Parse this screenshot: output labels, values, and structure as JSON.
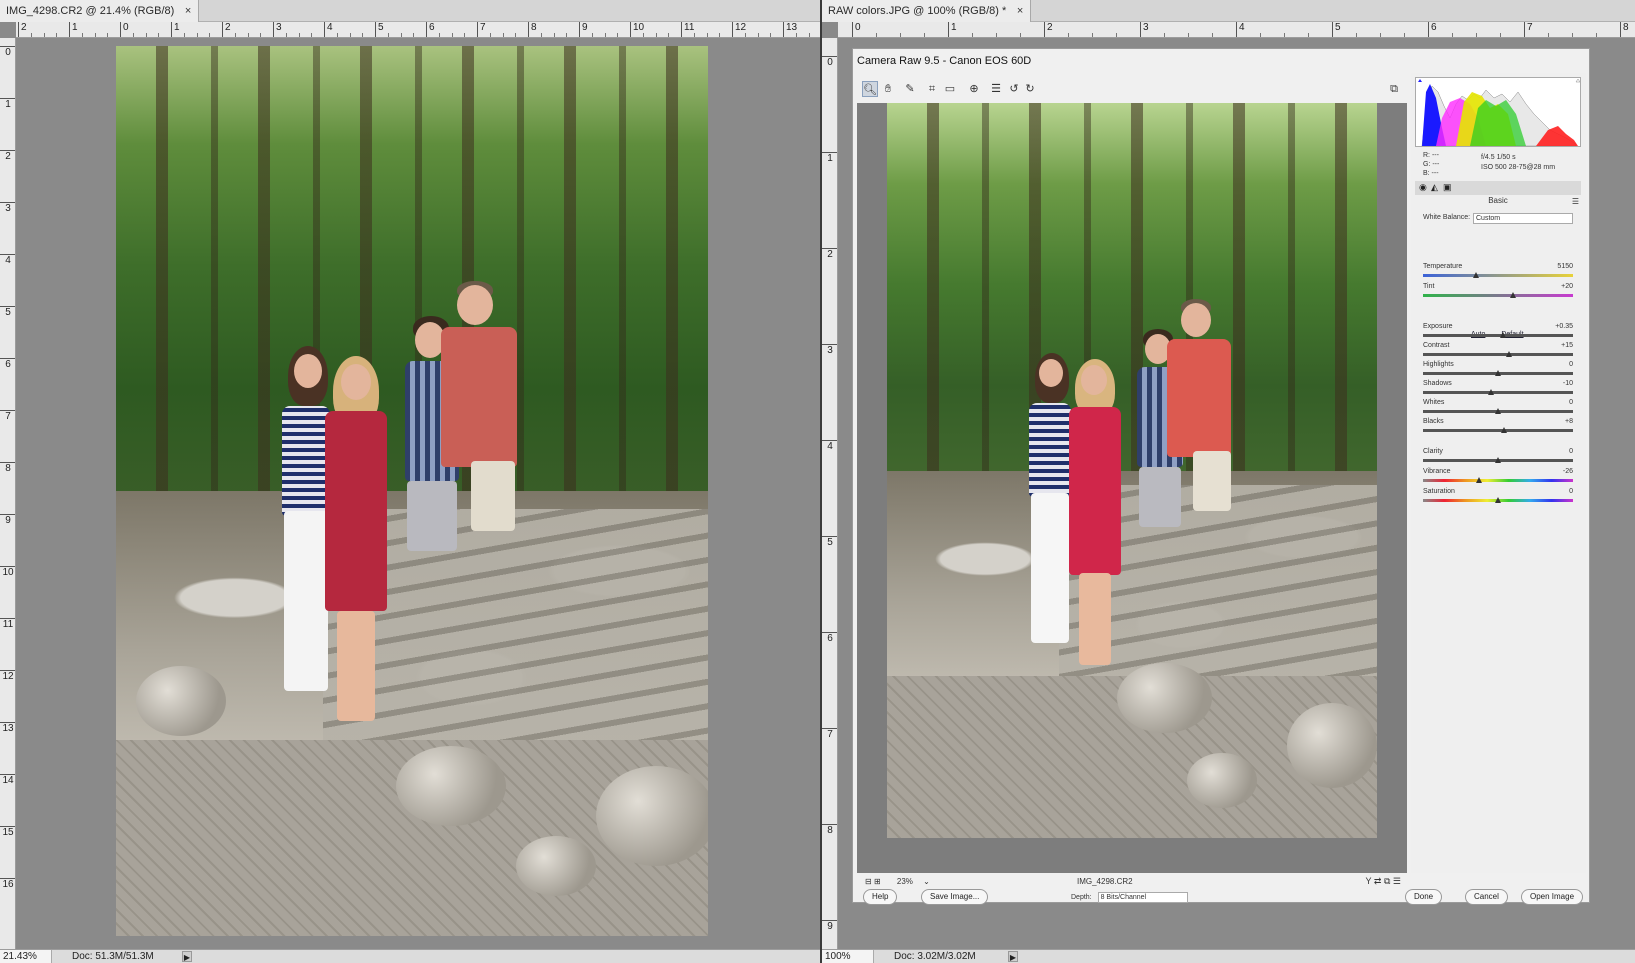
{
  "left_doc": {
    "tab_title": "IMG_4298.CR2 @ 21.4% (RGB/8)",
    "close_glyph": "×",
    "ruler_top_labels": [
      "2",
      "1",
      "0",
      "1",
      "2",
      "3",
      "4",
      "5",
      "6",
      "7",
      "8",
      "9",
      "10",
      "11",
      "12",
      "13"
    ],
    "ruler_left_labels": [
      "0",
      "1",
      "2",
      "3",
      "4",
      "5",
      "6",
      "7",
      "8",
      "9",
      "10",
      "11",
      "12",
      "13",
      "14",
      "15",
      "16"
    ],
    "status_zoom": "21.43%",
    "status_doc": "Doc: 51.3M/51.3M"
  },
  "right_doc": {
    "tab_title": "RAW colors.JPG @ 100% (RGB/8) *",
    "close_glyph": "×",
    "ruler_top_labels": [
      "0",
      "1",
      "2",
      "3",
      "4",
      "5",
      "6",
      "7",
      "8"
    ],
    "ruler_left_labels": [
      "0",
      "1",
      "2",
      "3",
      "4",
      "5",
      "6",
      "7",
      "8",
      "9"
    ],
    "status_zoom": "100%",
    "status_doc": "Doc: 3.02M/3.02M"
  },
  "camera_raw": {
    "title": "Camera Raw 9.5  -  Canon EOS 60D",
    "histogram_readout": {
      "r": "R:   ---",
      "g": "G:   ---",
      "b": "B:   ---",
      "aperture_shutter": "f/4.5    1/50 s",
      "iso_lens": "ISO 500    28-75@28 mm"
    },
    "panel_heading": "Basic",
    "white_balance_label": "White Balance:",
    "white_balance_value": "Custom",
    "auto_label": "Auto",
    "default_label": "Default",
    "sliders": [
      {
        "label": "Temperature",
        "value": "5150",
        "position": 0.35
      },
      {
        "label": "Tint",
        "value": "+20",
        "position": 0.6
      },
      {
        "label": "Exposure",
        "value": "+0.35",
        "position": 0.53
      },
      {
        "label": "Contrast",
        "value": "+15",
        "position": 0.57
      },
      {
        "label": "Highlights",
        "value": "0",
        "position": 0.5
      },
      {
        "label": "Shadows",
        "value": "-10",
        "position": 0.45
      },
      {
        "label": "Whites",
        "value": "0",
        "position": 0.5
      },
      {
        "label": "Blacks",
        "value": "+8",
        "position": 0.54
      },
      {
        "label": "Clarity",
        "value": "0",
        "position": 0.5
      },
      {
        "label": "Vibrance",
        "value": "-26",
        "position": 0.37
      },
      {
        "label": "Saturation",
        "value": "0",
        "position": 0.5
      }
    ],
    "preview_zoom": "23%",
    "preview_filename": "IMG_4298.CR2",
    "depth_label": "Depth:",
    "depth_value": "8 Bits/Channel",
    "buttons": {
      "help": "Help",
      "save_image": "Save Image...",
      "done": "Done",
      "cancel": "Cancel",
      "open_image": "Open Image"
    }
  }
}
